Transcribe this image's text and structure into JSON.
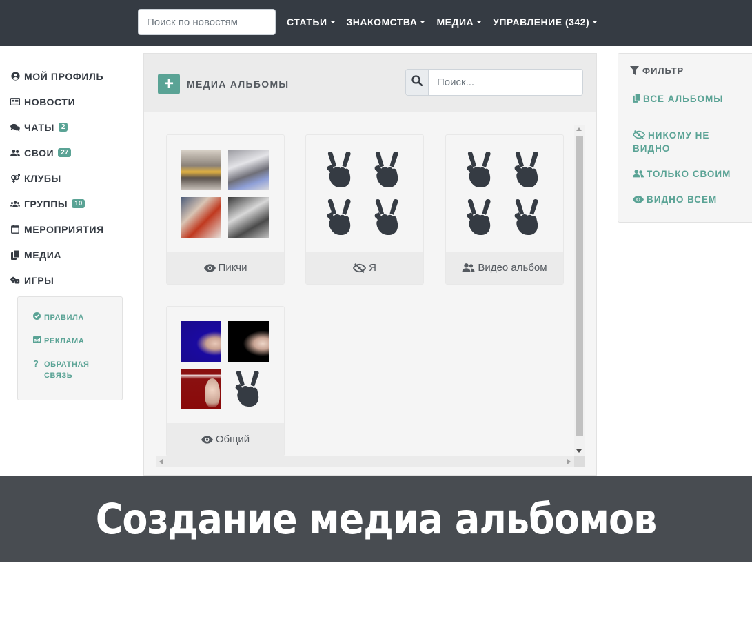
{
  "header": {
    "search_placeholder": "Поиск по новостям",
    "menu": [
      {
        "label": "СТАТЬИ"
      },
      {
        "label": "ЗНАКОМСТВА"
      },
      {
        "label": "МЕДИА"
      },
      {
        "label": "УПРАВЛЕНИЕ (342)"
      }
    ]
  },
  "sidebar": {
    "items": [
      {
        "label": "МОЙ ПРОФИЛЬ",
        "icon": "user-circle-icon"
      },
      {
        "label": "НОВОСТИ",
        "icon": "newspaper-icon"
      },
      {
        "label": "ЧАТЫ",
        "icon": "comments-icon",
        "badge": "2"
      },
      {
        "label": "СВОИ",
        "icon": "user-friends-icon",
        "badge": "27"
      },
      {
        "label": "КЛУБЫ",
        "icon": "venus-mars-icon"
      },
      {
        "label": "ГРУППЫ",
        "icon": "users-icon",
        "badge": "10"
      },
      {
        "label": "МЕРОПРИЯТИЯ",
        "icon": "calendar-icon"
      },
      {
        "label": "МЕДИА",
        "icon": "copy-icon"
      },
      {
        "label": "ИГРЫ",
        "icon": "dice-icon"
      }
    ],
    "links": [
      {
        "label": "ПРАВИЛА",
        "icon": "check-circle-icon"
      },
      {
        "label": "РЕКЛАМА",
        "icon": "ad-icon"
      },
      {
        "label": "ОБРАТНАЯ СВЯЗЬ",
        "icon": "question-icon"
      }
    ]
  },
  "main": {
    "add_label": "+",
    "title": "МЕДИА АЛЬБОМЫ",
    "search_placeholder": "Поиск...",
    "albums": [
      {
        "name": "Пикчи",
        "visibility_icon": "eye-icon"
      },
      {
        "name": "Я",
        "visibility_icon": "eye-slash-icon"
      },
      {
        "name": "Видео альбом",
        "visibility_icon": "user-friends-icon"
      },
      {
        "name": "Общий",
        "visibility_icon": "eye-icon"
      }
    ]
  },
  "filter": {
    "title": "ФИЛЬТР",
    "all": "ВСЕ АЛЬБОМЫ",
    "nobody": "НИКОМУ НЕ ВИДНО",
    "friends": "ТОЛЬКО СВОИМ",
    "everyone": "ВИДНО ВСЕМ"
  },
  "banner": {
    "text": "Создание медиа альбомов"
  },
  "colors": {
    "navbar": "#353b43",
    "accent": "#5aa395",
    "banner": "#484c51"
  }
}
